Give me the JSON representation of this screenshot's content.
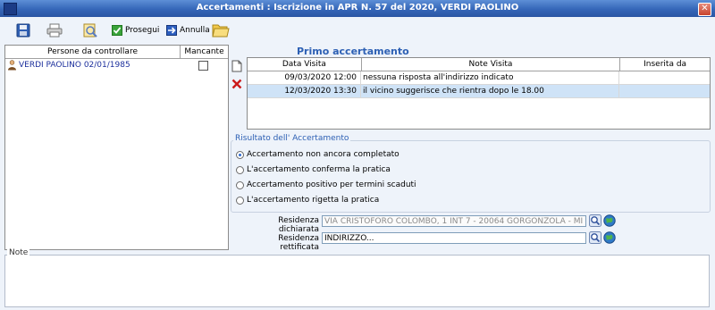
{
  "window": {
    "title": "Accertamenti : Iscrizione in APR N. 57 del 2020, VERDI PAOLINO",
    "close_icon": "close-icon"
  },
  "toolbar": {
    "prosegui_label": "Prosegui",
    "annulla_label": "Annulla"
  },
  "persons": {
    "col_person": "Persone da controllare",
    "col_missing": "Mancante",
    "rows": [
      {
        "name": "VERDI PAOLINO 02/01/1985",
        "missing": false
      }
    ]
  },
  "section": {
    "title": "Primo accertamento"
  },
  "visits": {
    "col_date": "Data Visita",
    "col_notes": "Note Visita",
    "col_inserted": "Inserita da",
    "rows": [
      {
        "date": "09/03/2020 12:00",
        "note": "nessuna risposta all'indirizzo indicato",
        "inserted": ""
      },
      {
        "date": "12/03/2020 13:30",
        "note": "il vicino suggerisce che rientra dopo le 18.00",
        "inserted": ""
      }
    ]
  },
  "result": {
    "legend": "Risultato dell' Accertamento",
    "options": [
      {
        "label": "Accertamento non ancora completato",
        "selected": true
      },
      {
        "label": "L'accertamento conferma la pratica",
        "selected": false
      },
      {
        "label": "Accertamento positivo per termini scaduti",
        "selected": false
      },
      {
        "label": "L'accertamento rigetta la pratica",
        "selected": false
      }
    ]
  },
  "address": {
    "declared_label": "Residenza dichiarata",
    "declared_value": "VIA CRISTOFORO COLOMBO, 1 INT 7 - 20064 GORGONZOLA - MI",
    "corrected_label": "Residenza rettificata",
    "corrected_value": "INDIRIZZO..."
  },
  "notes": {
    "legend": "Note",
    "value": ""
  }
}
